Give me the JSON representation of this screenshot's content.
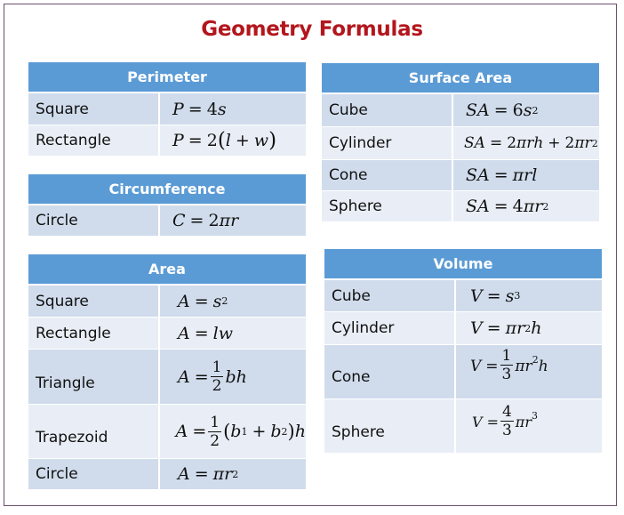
{
  "title": "Geometry Formulas",
  "colors": {
    "title": "#b3161d",
    "header_bg": "#5b9bd5",
    "row_dark": "#d0dcec",
    "row_light": "#e9eef6",
    "frame_border": "#6e4f6e"
  },
  "tables": {
    "perimeter": {
      "header": "Perimeter",
      "rows": [
        {
          "shape": "Square",
          "formula": "P = 4s"
        },
        {
          "shape": "Rectangle",
          "formula": "P = 2(l + w)"
        }
      ]
    },
    "circumference": {
      "header": "Circumference",
      "rows": [
        {
          "shape": "Circle",
          "formula": "C = 2πr"
        }
      ]
    },
    "area": {
      "header": "Area",
      "rows": [
        {
          "shape": "Square",
          "formula": "A = s²"
        },
        {
          "shape": "Rectangle",
          "formula": "A = lw"
        },
        {
          "shape": "Triangle",
          "formula": "A = (1/2)bh"
        },
        {
          "shape": "Trapezoid",
          "formula": "A = (1/2)(b₁ + b₂)h"
        },
        {
          "shape": "Circle",
          "formula": "A = πr²"
        }
      ]
    },
    "surface_area": {
      "header": "Surface Area",
      "rows": [
        {
          "shape": "Cube",
          "formula": "SA = 6s²"
        },
        {
          "shape": "Cylinder",
          "formula": "SA = 2πrh + 2πr²"
        },
        {
          "shape": "Cone",
          "formula": "SA = πrl"
        },
        {
          "shape": "Sphere",
          "formula": "SA = 4πr²"
        }
      ]
    },
    "volume": {
      "header": "Volume",
      "rows": [
        {
          "shape": "Cube",
          "formula": "V = s³"
        },
        {
          "shape": "Cylinder",
          "formula": "V = πr²h"
        },
        {
          "shape": "Cone",
          "formula": "V = (1/3)πr²h"
        },
        {
          "shape": "Sphere",
          "formula": "V = (4/3)πr³"
        }
      ]
    }
  },
  "math_parts": {
    "eq": "=",
    "plus": "+",
    "pi": "π",
    "two": "2",
    "three": "3",
    "four": "4",
    "six": "6",
    "one": "1",
    "lparen": "(",
    "rparen": ")"
  }
}
